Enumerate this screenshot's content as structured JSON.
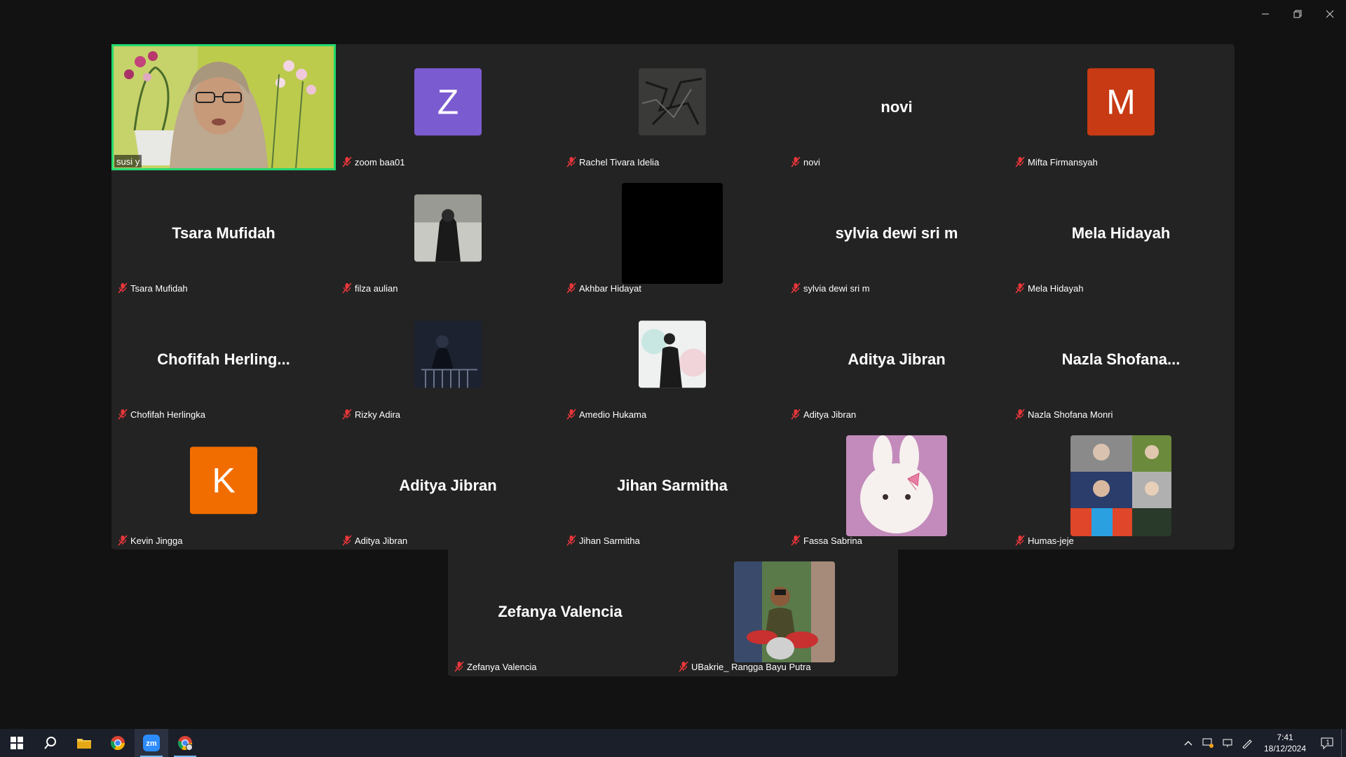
{
  "window": {
    "minimize_glyph": "—",
    "restore_glyph": "❐",
    "close_glyph": "✕"
  },
  "participants": [
    {
      "name": "susi y",
      "type": "video",
      "active": true
    },
    {
      "name": "zoom baa01",
      "type": "letter",
      "letter": "Z",
      "color": "#7b5bd0"
    },
    {
      "name": "Rachel Tivara Idelia",
      "type": "photo",
      "photo": "dark-texture"
    },
    {
      "name": "novi",
      "type": "name",
      "display": "novi"
    },
    {
      "name": "Mifta Firmansyah",
      "type": "letter",
      "letter": "M",
      "color": "#c73a14"
    },
    {
      "name": "Tsara Mufidah",
      "type": "name",
      "display": "Tsara Mufidah"
    },
    {
      "name": "filza aulian",
      "type": "photo",
      "photo": "hijab-person"
    },
    {
      "name": "Akhbar Hidayat",
      "type": "photo",
      "photo": "black"
    },
    {
      "name": "sylvia dewi sri m",
      "type": "name",
      "display": "sylvia dewi sri m"
    },
    {
      "name": "Mela Hidayah",
      "type": "name",
      "display": "Mela Hidayah"
    },
    {
      "name": "Chofifah Herlingka",
      "type": "name",
      "display": "Chofifah  Herling..."
    },
    {
      "name": "Rizky Adira",
      "type": "photo",
      "photo": "night-person"
    },
    {
      "name": "Amedio Hukama",
      "type": "photo",
      "photo": "light-person"
    },
    {
      "name": "Aditya Jibran",
      "type": "name",
      "display": "Aditya Jibran"
    },
    {
      "name": "Nazla Shofana Monri",
      "type": "name",
      "display": "Nazla  Shofana..."
    },
    {
      "name": "Kevin Jingga",
      "type": "letter",
      "letter": "K",
      "color": "#f26d00"
    },
    {
      "name": "Aditya Jibran",
      "type": "name",
      "display": "Aditya Jibran"
    },
    {
      "name": "Jihan Sarmitha",
      "type": "name",
      "display": "Jihan Sarmitha"
    },
    {
      "name": "Fassa Sabrina",
      "type": "photo",
      "photo": "bunny"
    },
    {
      "name": "Humas-jeje",
      "type": "photo",
      "photo": "collage"
    },
    {
      "name": "Zefanya Valencia",
      "type": "name",
      "display": "Zefanya Valencia"
    },
    {
      "name": "UBakrie_ Rangga Bayu Putra",
      "type": "photo",
      "photo": "drummer"
    }
  ],
  "taskbar": {
    "apps": [
      "start-icon",
      "search-icon",
      "file-explorer-icon",
      "chrome-icon",
      "zoom-icon",
      "chrome-profile-icon"
    ],
    "clock_time": "7:41",
    "clock_date": "18/12/2024",
    "notification_count": "1"
  }
}
